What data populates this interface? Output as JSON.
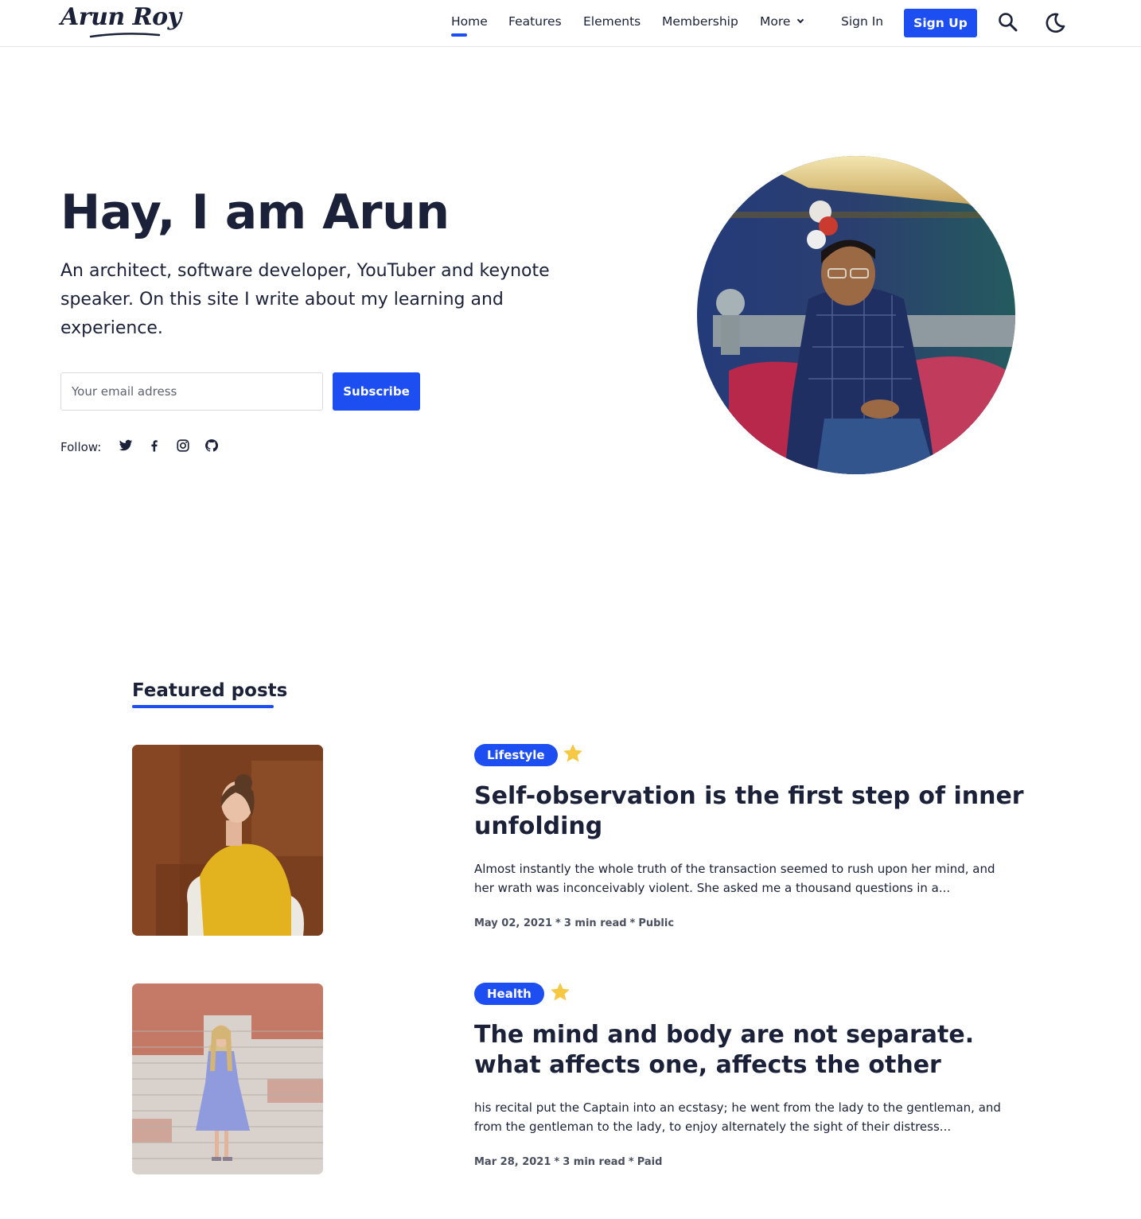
{
  "header": {
    "logo": "Arun Roy",
    "nav": [
      "Home",
      "Features",
      "Elements",
      "Membership"
    ],
    "more_label": "More",
    "signin_label": "Sign In",
    "signup_label": "Sign Up",
    "accent_color": "#1d4ef2"
  },
  "hero": {
    "title": "Hay, I am Arun",
    "description": "An architect, software developer, YouTuber and keynote speaker. On this site I write about my learning and experience.",
    "email_placeholder": "Your email adress",
    "subscribe_label": "Subscribe",
    "follow_label": "Follow:",
    "social_icons": [
      "twitter-icon",
      "facebook-icon",
      "instagram-icon",
      "github-icon"
    ]
  },
  "featured": {
    "heading": "Featured posts",
    "posts": [
      {
        "tag": "Lifestyle",
        "featured": true,
        "title": "Self-observation is the first step of inner unfolding",
        "excerpt": "Almost instantly the whole truth of the transaction seemed to rush upon her mind, and her wrath was inconceivably violent. She asked me a thousand questions in a...",
        "date": "May 02, 2021",
        "read_time": "3 min read",
        "access": "Public"
      },
      {
        "tag": "Health",
        "featured": true,
        "title": "The mind and body are not separate. what affects one, affects the other",
        "excerpt": "his recital put the Captain into an ecstasy; he went from the lady to the gentleman, and from the gentleman to the lady, to enjoy alternately the sight of their distress...",
        "date": "Mar 28, 2021",
        "read_time": "3 min read",
        "access": "Paid"
      }
    ]
  }
}
